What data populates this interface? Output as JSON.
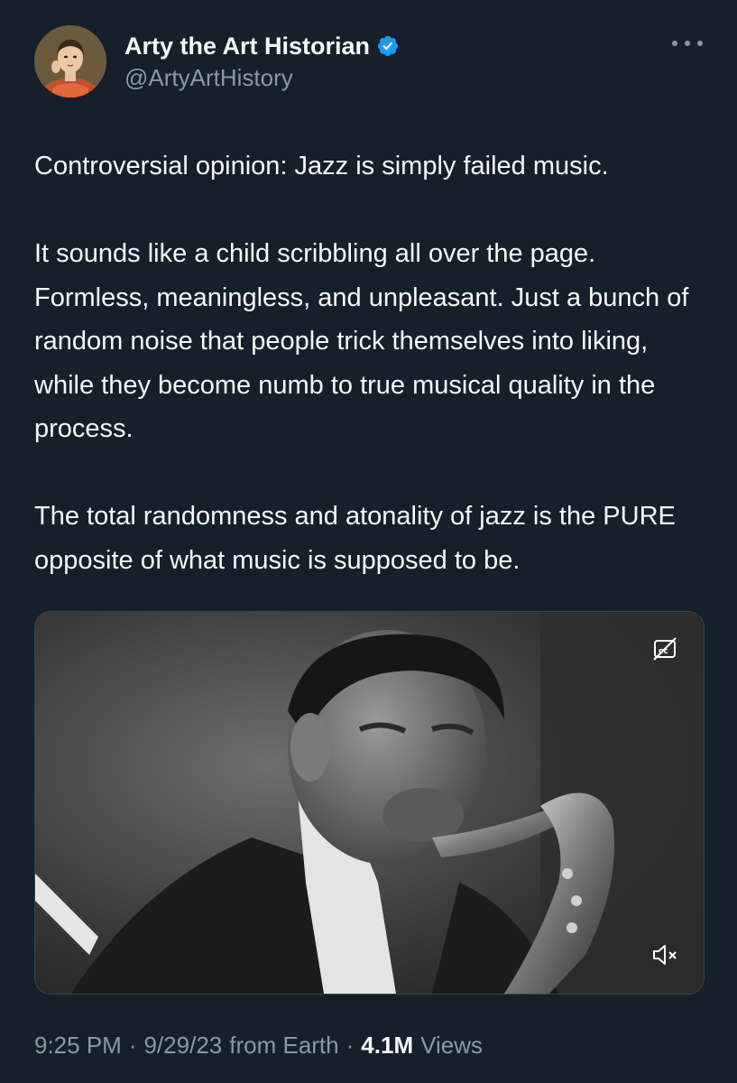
{
  "author": {
    "display_name": "Arty the Art Historian",
    "handle": "@ArtyArtHistory",
    "verified": true,
    "avatar_icon": "portrait-painting-avatar",
    "verified_color": "#1d9bf0"
  },
  "tweet": {
    "paragraphs": [
      "Controversial opinion: Jazz is simply failed music.",
      "It sounds like a child scribbling all over the page. Formless, meaningless, and unpleasant. Just a bunch of random noise that people trick themselves into liking, while they become numb to true musical quality in the process.",
      "The total randomness and atonality of jazz is the PURE opposite of what music is supposed to be."
    ]
  },
  "media": {
    "type": "video",
    "description_icon": "saxophone-player-video",
    "captions_icon": "captions-off-icon",
    "mute_icon": "muted-speaker-icon"
  },
  "meta": {
    "time": "9:25 PM",
    "date": "9/29/23",
    "source": "from Earth",
    "views_count": "4.1M",
    "views_label": "Views",
    "separator": "·"
  },
  "theme": {
    "background": "#15202b",
    "text": "#f7f9f9",
    "secondary_text": "#8b98a5"
  }
}
